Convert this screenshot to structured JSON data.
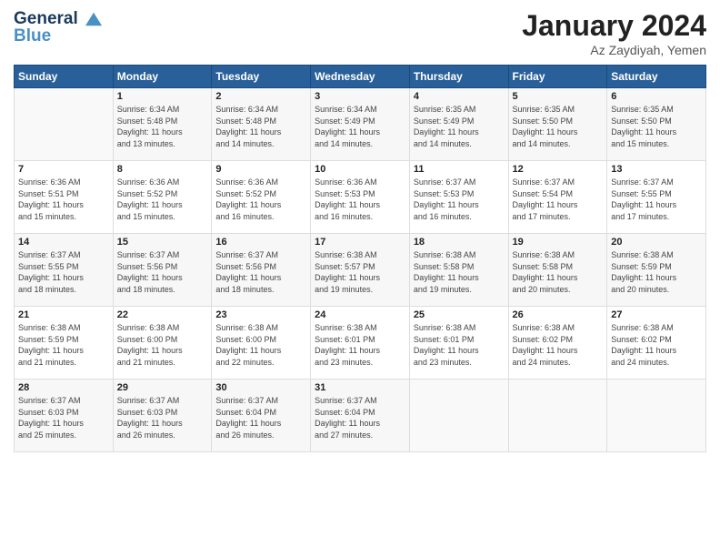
{
  "header": {
    "logo_line1": "General",
    "logo_line2": "Blue",
    "month_title": "January 2024",
    "location": "Az Zaydiyah, Yemen"
  },
  "weekdays": [
    "Sunday",
    "Monday",
    "Tuesday",
    "Wednesday",
    "Thursday",
    "Friday",
    "Saturday"
  ],
  "weeks": [
    [
      {
        "day": "",
        "info": ""
      },
      {
        "day": "1",
        "info": "Sunrise: 6:34 AM\nSunset: 5:48 PM\nDaylight: 11 hours\nand 13 minutes."
      },
      {
        "day": "2",
        "info": "Sunrise: 6:34 AM\nSunset: 5:48 PM\nDaylight: 11 hours\nand 14 minutes."
      },
      {
        "day": "3",
        "info": "Sunrise: 6:34 AM\nSunset: 5:49 PM\nDaylight: 11 hours\nand 14 minutes."
      },
      {
        "day": "4",
        "info": "Sunrise: 6:35 AM\nSunset: 5:49 PM\nDaylight: 11 hours\nand 14 minutes."
      },
      {
        "day": "5",
        "info": "Sunrise: 6:35 AM\nSunset: 5:50 PM\nDaylight: 11 hours\nand 14 minutes."
      },
      {
        "day": "6",
        "info": "Sunrise: 6:35 AM\nSunset: 5:50 PM\nDaylight: 11 hours\nand 15 minutes."
      }
    ],
    [
      {
        "day": "7",
        "info": "Sunrise: 6:36 AM\nSunset: 5:51 PM\nDaylight: 11 hours\nand 15 minutes."
      },
      {
        "day": "8",
        "info": "Sunrise: 6:36 AM\nSunset: 5:52 PM\nDaylight: 11 hours\nand 15 minutes."
      },
      {
        "day": "9",
        "info": "Sunrise: 6:36 AM\nSunset: 5:52 PM\nDaylight: 11 hours\nand 16 minutes."
      },
      {
        "day": "10",
        "info": "Sunrise: 6:36 AM\nSunset: 5:53 PM\nDaylight: 11 hours\nand 16 minutes."
      },
      {
        "day": "11",
        "info": "Sunrise: 6:37 AM\nSunset: 5:53 PM\nDaylight: 11 hours\nand 16 minutes."
      },
      {
        "day": "12",
        "info": "Sunrise: 6:37 AM\nSunset: 5:54 PM\nDaylight: 11 hours\nand 17 minutes."
      },
      {
        "day": "13",
        "info": "Sunrise: 6:37 AM\nSunset: 5:55 PM\nDaylight: 11 hours\nand 17 minutes."
      }
    ],
    [
      {
        "day": "14",
        "info": "Sunrise: 6:37 AM\nSunset: 5:55 PM\nDaylight: 11 hours\nand 18 minutes."
      },
      {
        "day": "15",
        "info": "Sunrise: 6:37 AM\nSunset: 5:56 PM\nDaylight: 11 hours\nand 18 minutes."
      },
      {
        "day": "16",
        "info": "Sunrise: 6:37 AM\nSunset: 5:56 PM\nDaylight: 11 hours\nand 18 minutes."
      },
      {
        "day": "17",
        "info": "Sunrise: 6:38 AM\nSunset: 5:57 PM\nDaylight: 11 hours\nand 19 minutes."
      },
      {
        "day": "18",
        "info": "Sunrise: 6:38 AM\nSunset: 5:58 PM\nDaylight: 11 hours\nand 19 minutes."
      },
      {
        "day": "19",
        "info": "Sunrise: 6:38 AM\nSunset: 5:58 PM\nDaylight: 11 hours\nand 20 minutes."
      },
      {
        "day": "20",
        "info": "Sunrise: 6:38 AM\nSunset: 5:59 PM\nDaylight: 11 hours\nand 20 minutes."
      }
    ],
    [
      {
        "day": "21",
        "info": "Sunrise: 6:38 AM\nSunset: 5:59 PM\nDaylight: 11 hours\nand 21 minutes."
      },
      {
        "day": "22",
        "info": "Sunrise: 6:38 AM\nSunset: 6:00 PM\nDaylight: 11 hours\nand 21 minutes."
      },
      {
        "day": "23",
        "info": "Sunrise: 6:38 AM\nSunset: 6:00 PM\nDaylight: 11 hours\nand 22 minutes."
      },
      {
        "day": "24",
        "info": "Sunrise: 6:38 AM\nSunset: 6:01 PM\nDaylight: 11 hours\nand 23 minutes."
      },
      {
        "day": "25",
        "info": "Sunrise: 6:38 AM\nSunset: 6:01 PM\nDaylight: 11 hours\nand 23 minutes."
      },
      {
        "day": "26",
        "info": "Sunrise: 6:38 AM\nSunset: 6:02 PM\nDaylight: 11 hours\nand 24 minutes."
      },
      {
        "day": "27",
        "info": "Sunrise: 6:38 AM\nSunset: 6:02 PM\nDaylight: 11 hours\nand 24 minutes."
      }
    ],
    [
      {
        "day": "28",
        "info": "Sunrise: 6:37 AM\nSunset: 6:03 PM\nDaylight: 11 hours\nand 25 minutes."
      },
      {
        "day": "29",
        "info": "Sunrise: 6:37 AM\nSunset: 6:03 PM\nDaylight: 11 hours\nand 26 minutes."
      },
      {
        "day": "30",
        "info": "Sunrise: 6:37 AM\nSunset: 6:04 PM\nDaylight: 11 hours\nand 26 minutes."
      },
      {
        "day": "31",
        "info": "Sunrise: 6:37 AM\nSunset: 6:04 PM\nDaylight: 11 hours\nand 27 minutes."
      },
      {
        "day": "",
        "info": ""
      },
      {
        "day": "",
        "info": ""
      },
      {
        "day": "",
        "info": ""
      }
    ]
  ]
}
